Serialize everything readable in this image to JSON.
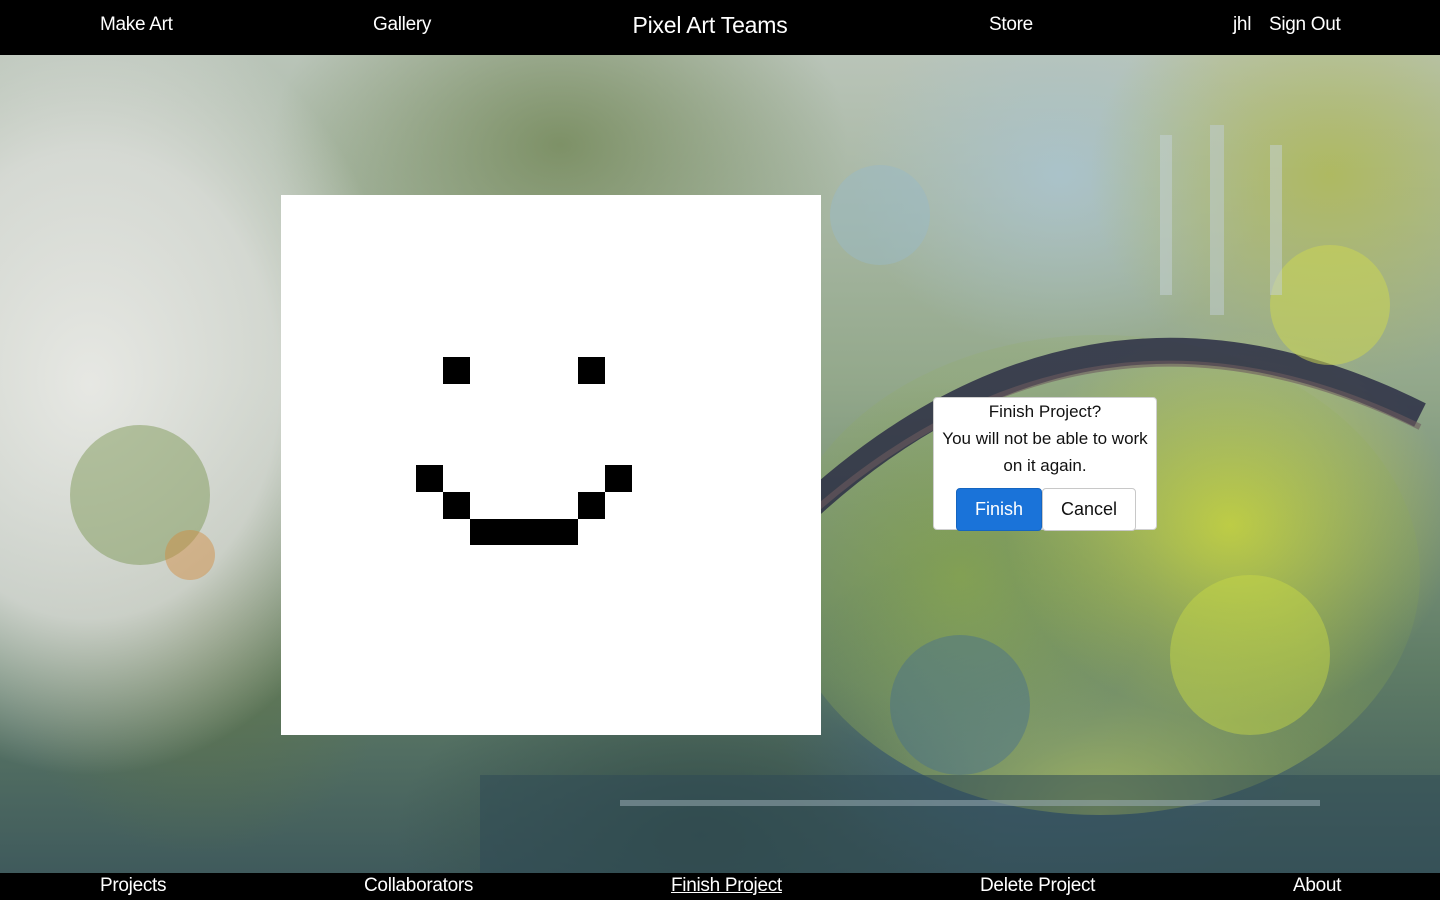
{
  "top_nav": {
    "make_art": "Make Art",
    "gallery": "Gallery",
    "brand": "Pixel Art Teams",
    "store": "Store",
    "username": "jhl",
    "sign_out": "Sign Out"
  },
  "bottom_nav": {
    "projects": "Projects",
    "collaborators": "Collaborators",
    "finish_project": "Finish Project",
    "delete_project": "Delete Project",
    "about": "About",
    "active": "finish_project"
  },
  "canvas": {
    "background_color": "#ffffff",
    "pixel_color": "#000000"
  },
  "dialog": {
    "title": "Finish Project?",
    "message": "You will not be able to work on it again.",
    "finish_label": "Finish",
    "cancel_label": "Cancel"
  },
  "colors": {
    "nav_background": "#000000",
    "nav_text": "#ffffff",
    "primary_button": "#1a73d9"
  }
}
